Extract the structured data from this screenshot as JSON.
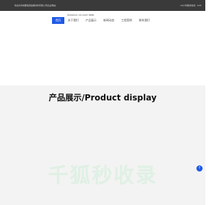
{
  "topbar": {
    "welcome": "欢迎访问成都恒源金属材料有限公司企业网站!",
    "hotline": "24小时服务热线：028"
  },
  "header": {
    "phone": "00002222  131-0007 8888"
  },
  "nav": {
    "items": [
      {
        "label": "首页",
        "active": true
      },
      {
        "label": "关于我们",
        "active": false
      },
      {
        "label": "产品展示",
        "active": false
      },
      {
        "label": "新闻动态",
        "active": false
      },
      {
        "label": "工程案例",
        "active": false
      },
      {
        "label": "联系我们",
        "active": false
      }
    ]
  },
  "product": {
    "title": "产品展示/Product display"
  },
  "watermark": {
    "text": "千狐秒收录"
  },
  "scroll_top": {
    "glyph": "↑"
  },
  "colors": {
    "accent": "#1f5ae6",
    "topbar_bg": "#3a3a3a",
    "section_bg": "#f3f3f3",
    "watermark": "#dff0e4"
  },
  "icons": {
    "scroll_top": "arrow-up-icon"
  }
}
